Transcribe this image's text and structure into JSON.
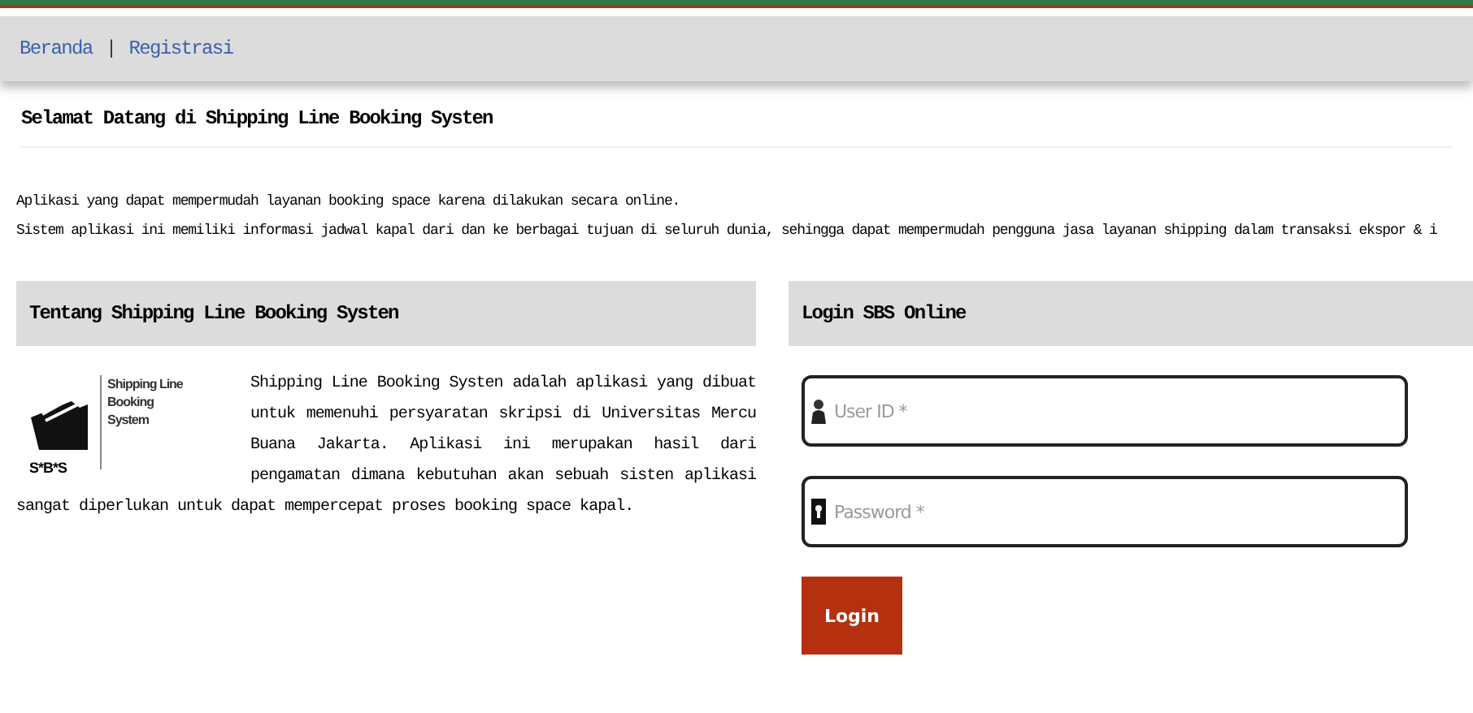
{
  "nav": {
    "links": [
      "Beranda",
      "Registrasi"
    ],
    "separator": "|"
  },
  "welcome": {
    "title": "Selamat Datang di Shipping Line Booking Systen"
  },
  "intro": [
    "Aplikasi yang dapat mempermudah layanan booking space karena dilakukan secara online.",
    "Sistem aplikasi ini memiliki informasi jadwal kapal dari dan ke berbagai tujuan di seluruh dunia, sehingga dapat mempermudah pengguna jasa layanan shipping dalam transaksi ekspor & i"
  ],
  "about": {
    "title": "Tentang Shipping Line Booking Systen",
    "logo": {
      "lines": [
        "Shipping Line",
        "Booking",
        "System"
      ],
      "caption": "S*B*S"
    },
    "text": "Shipping Line Booking Systen adalah aplikasi yang dibuat untuk memenuhi persyaratan skripsi di Universitas Mercu Buana Jakarta. Aplikasi ini merupakan hasil dari pengamatan dimana kebutuhan akan sebuah sisten aplikasi sangat diperlukan untuk dapat mempercepat proses booking space kapal."
  },
  "login": {
    "title": "Login SBS Online",
    "fields": [
      {
        "kind": "user",
        "placeholder": "User ID *"
      },
      {
        "kind": "password",
        "placeholder": "Password *"
      }
    ],
    "button": "Login"
  }
}
